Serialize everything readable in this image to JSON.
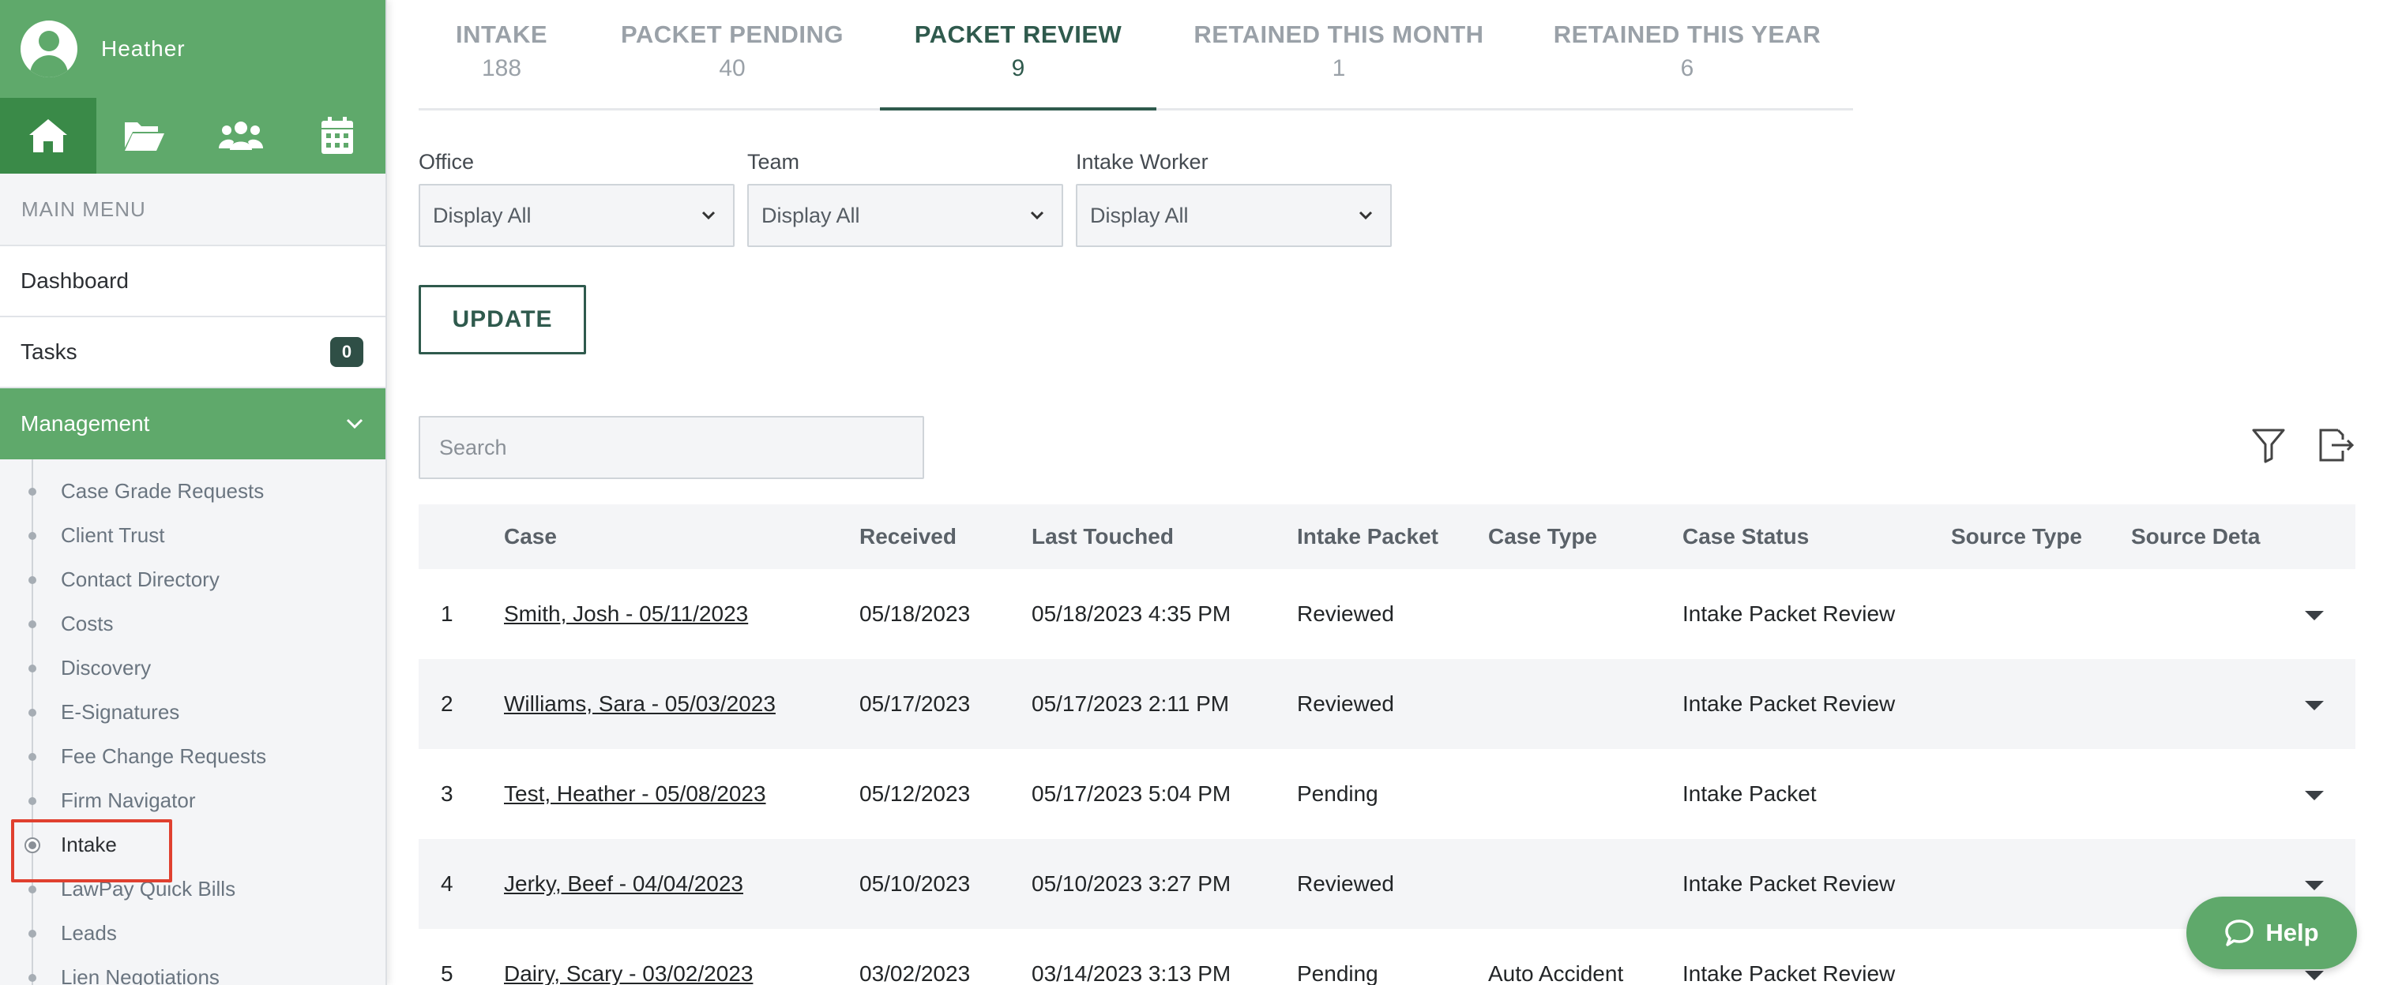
{
  "user": {
    "name": "Heather"
  },
  "sidebar": {
    "main_menu_label": "MAIN MENU",
    "dashboard": "Dashboard",
    "tasks": {
      "label": "Tasks",
      "count": "0"
    },
    "management": "Management",
    "sub_items": [
      "Case Grade Requests",
      "Client Trust",
      "Contact Directory",
      "Costs",
      "Discovery",
      "E-Signatures",
      "Fee Change Requests",
      "Firm Navigator",
      "Intake",
      "LawPay Quick Bills",
      "Leads",
      "Lien Negotiations"
    ]
  },
  "tabs": [
    {
      "label": "INTAKE",
      "count": "188"
    },
    {
      "label": "PACKET PENDING",
      "count": "40"
    },
    {
      "label": "PACKET REVIEW",
      "count": "9"
    },
    {
      "label": "RETAINED THIS MONTH",
      "count": "1"
    },
    {
      "label": "RETAINED THIS YEAR",
      "count": "6"
    }
  ],
  "filters": {
    "office": {
      "label": "Office",
      "value": "Display All"
    },
    "team": {
      "label": "Team",
      "value": "Display All"
    },
    "intake_worker": {
      "label": "Intake Worker",
      "value": "Display All"
    }
  },
  "update_label": "UPDATE",
  "search": {
    "placeholder": "Search"
  },
  "table": {
    "columns": [
      "",
      "Case",
      "Received",
      "Last Touched",
      "Intake Packet",
      "Case Type",
      "Case Status",
      "Source Type",
      "Source Deta"
    ],
    "rows": [
      {
        "num": "1",
        "case": "Smith, Josh - 05/11/2023",
        "received": "05/18/2023",
        "last_touched": "05/18/2023 4:35 PM",
        "packet": "Reviewed",
        "case_type": "",
        "status": "Intake Packet Review",
        "source_type": "",
        "source_detail": ""
      },
      {
        "num": "2",
        "case": "Williams, Sara - 05/03/2023",
        "received": "05/17/2023",
        "last_touched": "05/17/2023 2:11 PM",
        "packet": "Reviewed",
        "case_type": "",
        "status": "Intake Packet Review",
        "source_type": "",
        "source_detail": ""
      },
      {
        "num": "3",
        "case": "Test, Heather - 05/08/2023",
        "received": "05/12/2023",
        "last_touched": "05/17/2023 5:04 PM",
        "packet": "Pending",
        "case_type": "",
        "status": "Intake Packet",
        "source_type": "",
        "source_detail": ""
      },
      {
        "num": "4",
        "case": "Jerky, Beef - 04/04/2023",
        "received": "05/10/2023",
        "last_touched": "05/10/2023 3:27 PM",
        "packet": "Reviewed",
        "case_type": "",
        "status": "Intake Packet Review",
        "source_type": "",
        "source_detail": ""
      },
      {
        "num": "5",
        "case": "Dairy, Scary - 03/02/2023",
        "received": "03/02/2023",
        "last_touched": "03/14/2023 3:13 PM",
        "packet": "Pending",
        "case_type": "Auto Accident",
        "status": "Intake Packet Review",
        "source_type": "",
        "source_detail": ""
      }
    ]
  },
  "help_label": "Help",
  "colors": {
    "brand_green": "#5fa96b",
    "dark_green": "#2f5a4d",
    "highlight_red": "#e0402f"
  }
}
